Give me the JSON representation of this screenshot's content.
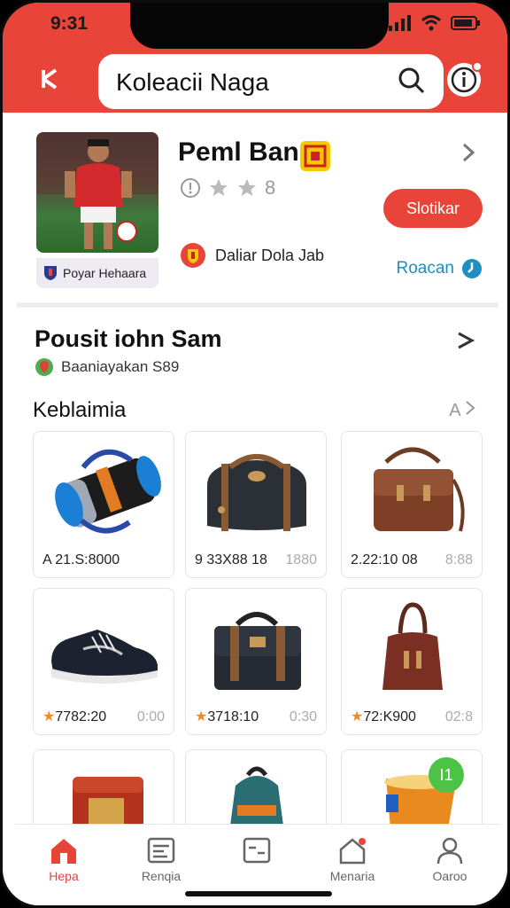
{
  "status": {
    "time": "9:31"
  },
  "header": {
    "title": "Koleacii Naga"
  },
  "profile": {
    "name": "Peml Ban",
    "rating": "8",
    "action_label": "Slotikar",
    "team": "Daliar Dola Jab",
    "photo_caption": "Poyar Hehaara",
    "react_label": "Roacan"
  },
  "section": {
    "title": "Pousit iohn Sam",
    "subtitle": "Baaniayakan S89",
    "category": "Keblaimia",
    "category_more": "A"
  },
  "products": [
    {
      "price": "A 21.S:8000",
      "sub": "",
      "icon": "foam-roller"
    },
    {
      "price": "9 33X88 18",
      "sub": "1880",
      "icon": "duffel-bag"
    },
    {
      "price": "2.22:10 08",
      "sub": "8:88",
      "icon": "leather-satchel"
    },
    {
      "price": "7782:20",
      "sub": "0:00",
      "icon": "sneaker"
    },
    {
      "price": "3718:10",
      "sub": "0:30",
      "icon": "messenger-bag"
    },
    {
      "price": "72:K900",
      "sub": "02:8",
      "icon": "handbag"
    }
  ],
  "fab_label": "I1",
  "nav": [
    {
      "label": "Hepa",
      "icon": "home-icon"
    },
    {
      "label": "Renqia",
      "icon": "list-icon"
    },
    {
      "label": "",
      "icon": "card-icon"
    },
    {
      "label": "Menaria",
      "icon": "bell-house-icon"
    },
    {
      "label": "Oaroo",
      "icon": "profile-icon"
    }
  ],
  "colors": {
    "accent": "#e8443a",
    "link": "#1f8fbf",
    "fab": "#4cc347"
  }
}
